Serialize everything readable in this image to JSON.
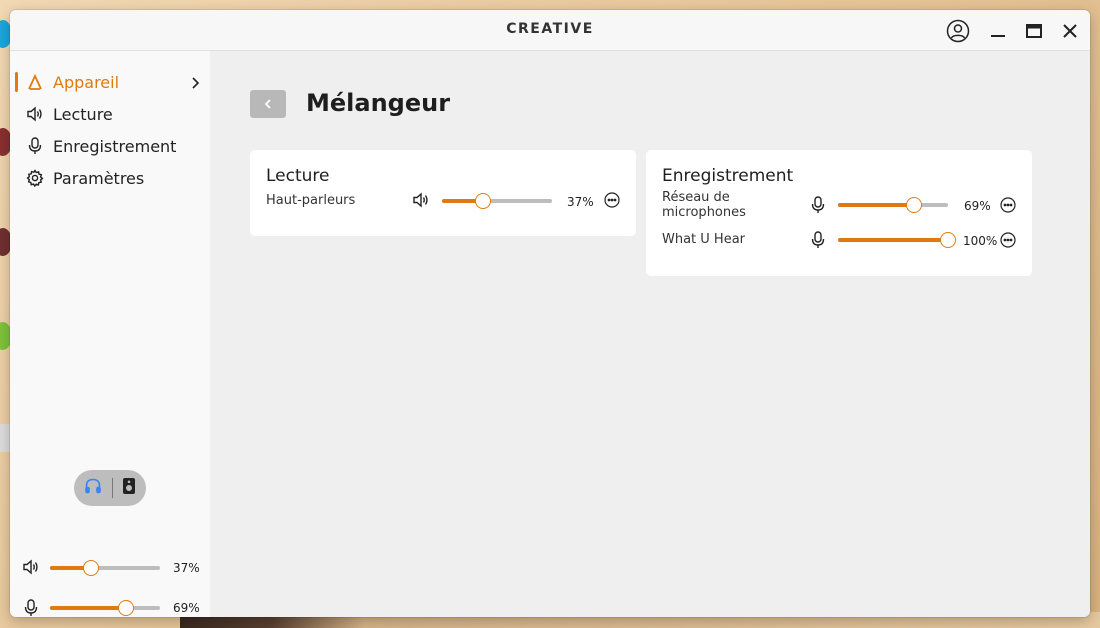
{
  "window": {
    "brand": "CREATIVE"
  },
  "sidebar": {
    "items": [
      {
        "label": "Appareil",
        "icon": "creative-logo-icon",
        "active": true
      },
      {
        "label": "Lecture",
        "icon": "speaker-icon"
      },
      {
        "label": "Enregistrement",
        "icon": "microphone-icon"
      },
      {
        "label": "Paramètres",
        "icon": "gear-icon"
      }
    ],
    "output_toggle": {
      "left_icon": "headphones-icon",
      "right_icon": "speaker-device-icon"
    },
    "sliders": [
      {
        "icon": "speaker-icon",
        "value": 37,
        "label": "37%"
      },
      {
        "icon": "microphone-icon",
        "value": 69,
        "label": "69%"
      }
    ]
  },
  "main": {
    "title": "Mélangeur",
    "playback": {
      "title": "Lecture",
      "rows": [
        {
          "label": "Haut-parleurs",
          "icon": "speaker-icon",
          "value": 37,
          "label_pct": "37%"
        }
      ]
    },
    "recording": {
      "title": "Enregistrement",
      "rows": [
        {
          "label": "Réseau de microphones",
          "icon": "microphone-icon",
          "value": 69,
          "label_pct": "69%"
        },
        {
          "label": "What U Hear",
          "icon": "microphone-icon",
          "value": 100,
          "label_pct": "100%"
        }
      ]
    }
  },
  "colors": {
    "accent": "#e07a10",
    "track": "#bdbdbd",
    "toggle_headphones": "#3b82f6"
  }
}
